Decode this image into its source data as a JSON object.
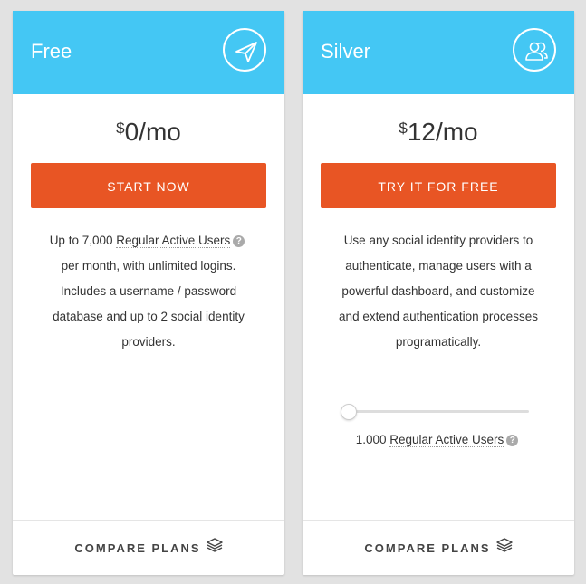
{
  "plans": [
    {
      "name": "Free",
      "icon": "paper-plane-icon",
      "price_currency": "$",
      "price_amount": "0/mo",
      "cta_label": "START NOW",
      "desc_part1": "Up to 7,000 ",
      "desc_link": "Regular Active Users",
      "desc_part2": " per month, with unlimited logins. Includes a username / password database and up to 2 social identity providers.",
      "compare_label": "COMPARE PLANS"
    },
    {
      "name": "Silver",
      "icon": "users-icon",
      "price_currency": "$",
      "price_amount": "12/mo",
      "cta_label": "TRY IT FOR FREE",
      "description": "Use any social identity providers to authenticate, manage users with a powerful dashboard, and customize and extend authentication processes programatically.",
      "slider_value": 0,
      "users_count": "1.000 ",
      "users_label": "Regular Active Users",
      "compare_label": "COMPARE PLANS"
    }
  ],
  "colors": {
    "header": "#44c7f4",
    "cta": "#e85524"
  },
  "help_glyph": "?"
}
